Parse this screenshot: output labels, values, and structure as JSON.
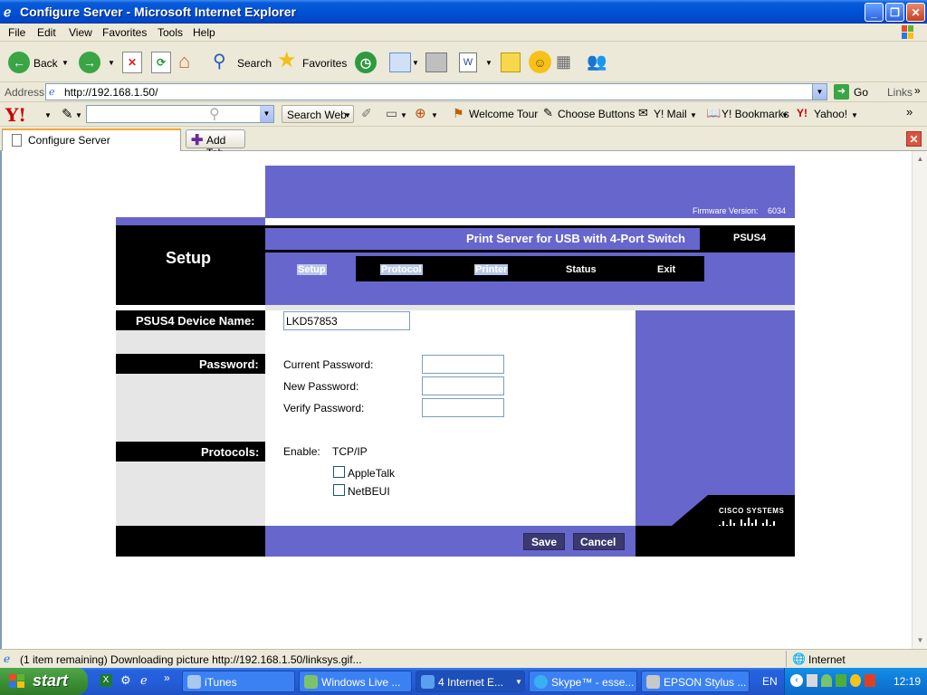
{
  "window": {
    "title": "Configure Server - Microsoft Internet Explorer"
  },
  "menu": [
    "File",
    "Edit",
    "View",
    "Favorites",
    "Tools",
    "Help"
  ],
  "toolbar": {
    "back_label": "Back",
    "search_label": "Search",
    "favorites_label": "Favorites"
  },
  "address": {
    "label": "Address",
    "url": "http://192.168.1.50/",
    "go_label": "Go",
    "links_label": "Links"
  },
  "yahoo": {
    "logo": "Y!",
    "search_web_label": "Search Web",
    "welcome_tour": "Welcome Tour",
    "choose_buttons": "Choose Buttons",
    "mail": "Y! Mail",
    "bookmarks": "Y! Bookmarks",
    "yahoo": "Yahoo!"
  },
  "tabs": {
    "active_label": "Configure Server",
    "add_tab_label": "Add Tab"
  },
  "page": {
    "firmware_label": "Firmware Version:",
    "firmware_value": "6034",
    "section_title": "Setup",
    "product_title": "Print Server for USB with 4-Port Switch",
    "model": "PSUS4",
    "nav": {
      "setup": "Setup",
      "protocol": "Protocol",
      "printer": "Printer",
      "status": "Status",
      "exit": "Exit"
    },
    "device_name_label": "PSUS4 Device Name:",
    "device_name_value": "LKD57853",
    "password_label": "Password:",
    "current_password_label": "Current Password:",
    "new_password_label": "New Password:",
    "verify_password_label": "Verify Password:",
    "protocols_label": "Protocols:",
    "enable_label": "Enable:",
    "tcpip_label": "TCP/IP",
    "appletalk_label": "AppleTalk",
    "netbeui_label": "NetBEUI",
    "appletalk_checked": false,
    "netbeui_checked": false,
    "save_label": "Save",
    "cancel_label": "Cancel",
    "brand": "Cisco Systems"
  },
  "statusbar": {
    "text": "(1 item remaining) Downloading picture http://192.168.1.50/linksys.gif...",
    "zone": "Internet"
  },
  "taskbar": {
    "start_label": "start",
    "tasks": [
      "iTunes",
      "Windows Live ...",
      "4 Internet E...",
      "Skype™ - esse...",
      "EPSON Stylus ..."
    ],
    "lang": "EN",
    "clock": "12:19"
  },
  "colors": {
    "linksys_purple": "#6766cc",
    "xp_blue": "#245edb",
    "start_green": "#3a8c33"
  }
}
